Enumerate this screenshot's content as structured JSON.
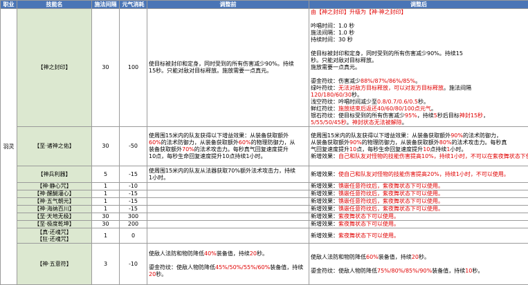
{
  "headers": [
    "职业",
    "技能名",
    "施法间隔",
    "元气消耗",
    "调整前",
    "调整后"
  ],
  "profession": "羽灵",
  "rows": [
    {
      "names": [
        "【神之封印】"
      ],
      "interval": "30",
      "cost": "100",
      "before": [
        [
          [
            "使目标被封印和定身，同时受到的所有伤害减少90%。持续",
            ""
          ]
        ],
        [
          [
            "15秒。只能对敌对目标释放。施放需要一点真元。",
            ""
          ]
        ]
      ],
      "after": [
        [
          [
            "由【神之封印】升级为【神·神之封印】",
            "red"
          ]
        ],
        [],
        [
          [
            "吟唱时间：1.0 秒",
            ""
          ]
        ],
        [
          [
            "施法间隔：1.0 秒",
            ""
          ]
        ],
        [
          [
            "持续时间：30 秒",
            ""
          ]
        ],
        [],
        [
          [
            "使目标被封印和定身，同时受到的所有伤害减少90%。持续15",
            ""
          ]
        ],
        [
          [
            "秒。只能对敌对目标释放。",
            ""
          ]
        ],
        [
          [
            "施放需要一点真元。",
            ""
          ]
        ],
        [],
        [
          [
            "鎏金符纹：伤害减少",
            ""
          ],
          [
            "88%/87%/86%/85%",
            "red"
          ],
          [
            "。",
            ""
          ]
        ],
        [
          [
            "绿叶符纹：",
            ""
          ],
          [
            "无法对敌方目标释放，可以对友方目标释放",
            "red"
          ],
          [
            "。施法间隔",
            ""
          ]
        ],
        [
          [
            "120/180/60/30",
            "red"
          ],
          [
            "秒。",
            ""
          ]
        ],
        [
          [
            "浅空符纹：吟唱时间减少至",
            ""
          ],
          [
            "0.8/0.7/0.6/0.5",
            "red"
          ],
          [
            "秒。",
            ""
          ]
        ],
        [
          [
            "鲜红符纹：",
            ""
          ],
          [
            "施放结束后返还40/60/80/100点元气",
            "red"
          ],
          [
            "。",
            ""
          ]
        ],
        [
          [
            "银石符纹：使目标受到的所有伤害减少",
            ""
          ],
          [
            "95%",
            "red"
          ],
          [
            "，持续",
            ""
          ],
          [
            "5",
            "red"
          ],
          [
            "秒后目标",
            ""
          ],
          [
            "神封15秒",
            "red"
          ],
          [
            "，",
            ""
          ]
        ],
        [
          [
            "5/55/50/45秒",
            "red"
          ],
          [
            "。",
            ""
          ],
          [
            "神封状态无法被解除",
            "red"
          ],
          [
            "。",
            ""
          ]
        ]
      ]
    },
    {
      "names": [
        "【至·诸神之佑】"
      ],
      "interval": "30",
      "cost": "-50",
      "before": [
        [
          [
            "使周围15米内的队友获得以下增益效果：从装备获取额外",
            ""
          ]
        ],
        [
          [
            "60%",
            "red"
          ],
          [
            "的法术防御力，从装备获取额外",
            ""
          ],
          [
            "60%",
            "red"
          ],
          [
            "的物理防御力，从",
            ""
          ]
        ],
        [
          [
            "装备获取额外",
            ""
          ],
          [
            "70%",
            "red"
          ],
          [
            "的法术攻击力。每秒真气回复速度提升",
            ""
          ]
        ],
        [
          [
            "10点，每秒生命回复速度提升10点持续1小时。",
            ""
          ]
        ]
      ],
      "after": [
        [
          [
            "使周围15米内的队友获得以下增益效果：从装备获取额外",
            ""
          ],
          [
            "90%",
            "red"
          ],
          [
            "的法术防御力，",
            ""
          ]
        ],
        [
          [
            "从装备获取额外",
            ""
          ],
          [
            "90%",
            "red"
          ],
          [
            "的物理防御力，从装备获取额外",
            ""
          ],
          [
            "80%",
            "red"
          ],
          [
            "的法术攻击力。每秒真",
            ""
          ]
        ],
        [
          [
            "气回复速度提升",
            ""
          ],
          [
            "10",
            "red"
          ],
          [
            "点，每秒生命回复速度提升",
            ""
          ],
          [
            "10",
            "red"
          ],
          [
            "点持续",
            ""
          ],
          [
            "1",
            "red"
          ],
          [
            "小时。",
            ""
          ]
        ],
        [
          [
            "新增效果：",
            ""
          ],
          [
            "自己和队友对怪物的技能伤害提高10%，持续1小时，不可以在紫夜舞状态下使用。",
            "red"
          ]
        ]
      ]
    },
    {
      "names": [
        "【神兵利器】"
      ],
      "interval": "5",
      "cost": "-15",
      "before": [
        [
          [
            "使周围15米内的队友从法器获取70%额外法术攻击力，持续",
            ""
          ]
        ],
        [
          [
            "1小时。",
            ""
          ]
        ]
      ],
      "after": [
        [
          [
            "新增效果：",
            ""
          ],
          [
            "使自己和队友对怪物的技能伤害提高20%，持续1小时，不可以使用。",
            "red"
          ]
        ]
      ]
    },
    {
      "names": [
        "【神·静心咒】"
      ],
      "interval": "1",
      "cost": "-10",
      "before": [],
      "after": [
        [
          [
            "新增效果：",
            ""
          ],
          [
            "镌嵌任意符纹后，紫夜舞状态下可以使用。",
            "red"
          ]
        ]
      ]
    },
    {
      "names": [
        "【神·醒醐灌心】"
      ],
      "interval": "1",
      "cost": "-15",
      "before": [],
      "after": [
        [
          [
            "新增效果：",
            ""
          ],
          [
            "镌嵌任意符纹后，紫夜舞状态下可以使用。",
            "red"
          ]
        ]
      ]
    },
    {
      "names": [
        "【神·五气朝元】"
      ],
      "interval": "1",
      "cost": "-15",
      "before": [],
      "after": [
        [
          [
            "新增效果：",
            ""
          ],
          [
            "镌嵌任意符纹后，紫夜舞状态下可以使用。",
            "red"
          ]
        ]
      ]
    },
    {
      "names": [
        "【神·海纳百川】"
      ],
      "interval": "1",
      "cost": "-15",
      "before": [],
      "after": [
        [
          [
            "新增效果：",
            ""
          ],
          [
            "镌嵌任意符纹后，紫夜舞状态下可以使用。",
            "red"
          ]
        ]
      ]
    },
    {
      "names": [
        "【至·天地无极】"
      ],
      "interval": "30",
      "cost": "300",
      "before": [],
      "after": [
        [
          [
            "新增效果：",
            ""
          ],
          [
            "紫夜舞状态下可以使用。",
            "red"
          ]
        ]
      ]
    },
    {
      "names": [
        "【至·极度乾坤】"
      ],
      "interval": "30",
      "cost": "200",
      "before": [],
      "after": [
        [
          [
            "新增效果：",
            ""
          ],
          [
            "紫夜舞状态下可以使用。",
            "red"
          ]
        ]
      ]
    },
    {
      "names": [
        "【真·还魂咒】",
        "【狂·还魂咒】"
      ],
      "interval": "1",
      "cost": "0",
      "before": [],
      "after": [
        [
          [
            "新增效果：",
            ""
          ],
          [
            "紫夜舞状态下可以使用。",
            "red"
          ]
        ]
      ]
    },
    {
      "names": [
        "【神·五意符】"
      ],
      "interval": "3",
      "cost": "-10",
      "before": [
        [
          [
            "使敌人法防和物防降低",
            ""
          ],
          [
            "40%",
            "red"
          ],
          [
            "装备值，持续",
            ""
          ],
          [
            "20",
            "red"
          ],
          [
            "秒。",
            ""
          ]
        ],
        [],
        [
          [
            "鎏金符纹：使敌人物防降低",
            ""
          ],
          [
            "45%/50%/55%/60%",
            "red"
          ],
          [
            "装备值，持续",
            ""
          ]
        ],
        [
          [
            "20",
            "red"
          ],
          [
            "秒。",
            ""
          ]
        ]
      ],
      "after": [
        [
          [
            "使敌人法防和物防降低",
            ""
          ],
          [
            "60%",
            "red"
          ],
          [
            "装备值，持续",
            ""
          ],
          [
            "20",
            "red"
          ],
          [
            "秒。",
            ""
          ]
        ],
        [],
        [
          [
            "鎏金符纹：使敌人物防降低",
            ""
          ],
          [
            "75%/80%/85%/90%",
            "red"
          ],
          [
            "装备值，持续",
            ""
          ],
          [
            "10",
            "red"
          ],
          [
            "秒。",
            ""
          ]
        ]
      ]
    }
  ]
}
